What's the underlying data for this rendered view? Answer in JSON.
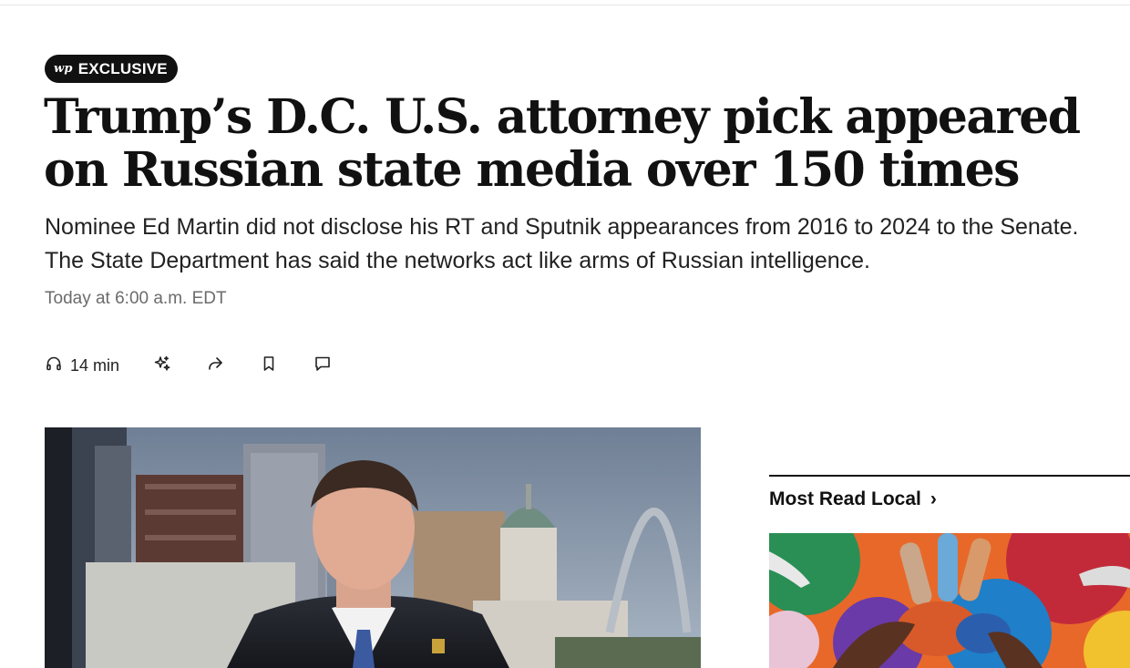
{
  "badge": {
    "logo": "wp",
    "label": "EXCLUSIVE"
  },
  "headline": "Trump’s D.C. U.S. attorney pick appeared on Russian state media over 150 times",
  "dek": "Nominee Ed Martin did not disclose his RT and Sputnik appearances from 2016 to 2024 to the Senate. The State Department has said the networks act like arms of Russian intelligence.",
  "dateline": "Today at 6:00 a.m. EDT",
  "actions": {
    "listen": {
      "icon": "headphones-icon",
      "label": "14 min"
    },
    "ai_summary": {
      "icon": "sparkles-icon"
    },
    "share": {
      "icon": "share-arrow-icon"
    },
    "save": {
      "icon": "bookmark-icon"
    },
    "comments": {
      "icon": "comment-icon"
    }
  },
  "sidebar": {
    "title": "Most Read Local",
    "chevron": "›"
  },
  "colors": {
    "text": "#111111",
    "muted": "#6b6b6b",
    "badge_bg": "#111111"
  }
}
